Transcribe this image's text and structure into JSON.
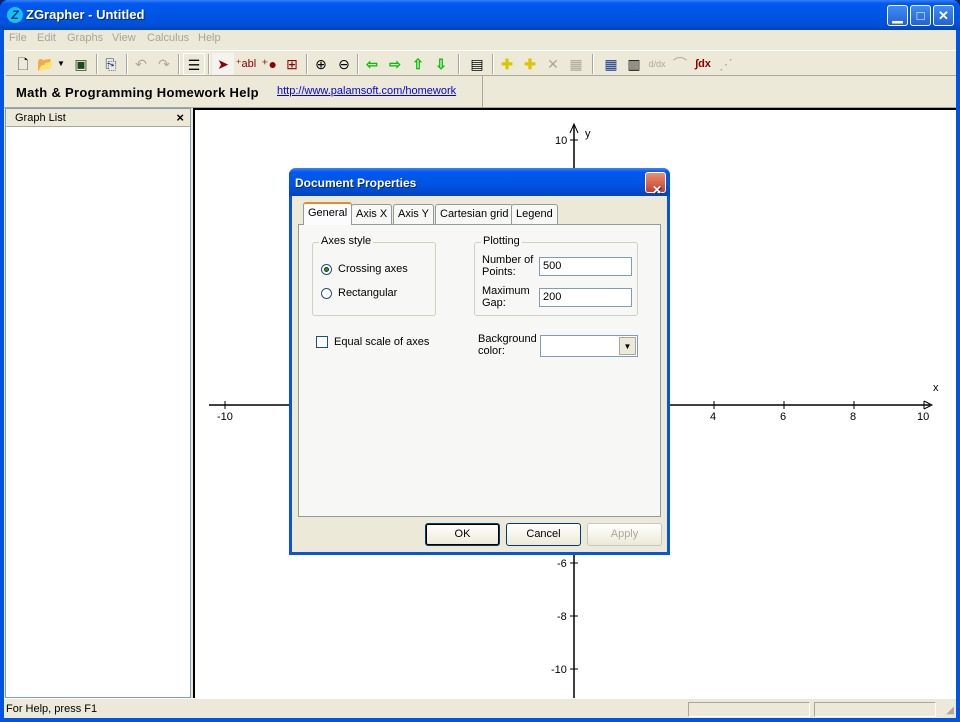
{
  "window": {
    "title": "ZGrapher - Untitled",
    "app_icon": "Z",
    "controls": {
      "minimize": "minimize-icon",
      "maximize": "maximize-icon",
      "close": "close-icon"
    }
  },
  "menu": [
    "File",
    "Edit",
    "Graphs",
    "View",
    "Calculus",
    "Help"
  ],
  "toolbar": [
    {
      "name": "new-icon",
      "glyph": "🗋"
    },
    {
      "name": "open-icon",
      "glyph": "📂"
    },
    {
      "name": "save-icon",
      "glyph": "💾"
    },
    {
      "name": "copy-icon",
      "glyph": "⎘"
    },
    {
      "name": "undo-icon",
      "glyph": "↶"
    },
    {
      "name": "redo-icon",
      "glyph": "↷"
    },
    {
      "name": "graph-list-icon",
      "glyph": "☰"
    },
    {
      "name": "select-pointer-icon",
      "glyph": "➤"
    },
    {
      "name": "add-label-icon",
      "glyph": "abl"
    },
    {
      "name": "add-point-icon",
      "glyph": "•"
    },
    {
      "name": "zoom-window-icon",
      "glyph": "⊞"
    },
    {
      "name": "zoom-in-icon",
      "glyph": "⊕"
    },
    {
      "name": "zoom-out-icon",
      "glyph": "⊖"
    },
    {
      "name": "pan-left-icon",
      "glyph": "⇦"
    },
    {
      "name": "pan-right-icon",
      "glyph": "⇨"
    },
    {
      "name": "pan-up-icon",
      "glyph": "⇧"
    },
    {
      "name": "pan-down-icon",
      "glyph": "⇩"
    },
    {
      "name": "document-properties-icon",
      "glyph": "▤"
    },
    {
      "name": "add-function-icon",
      "glyph": "✚"
    },
    {
      "name": "add-table-function-icon",
      "glyph": "✚"
    },
    {
      "name": "delete-graph-icon",
      "glyph": "✕"
    },
    {
      "name": "graph-properties-icon",
      "glyph": "▦"
    },
    {
      "name": "table-icon",
      "glyph": "▦"
    },
    {
      "name": "calculator-icon",
      "glyph": "▥"
    },
    {
      "name": "derivative-icon",
      "glyph": "d/dx"
    },
    {
      "name": "tangent-icon",
      "glyph": "⌒"
    },
    {
      "name": "integral-icon",
      "glyph": "∫dx"
    },
    {
      "name": "regression-icon",
      "glyph": "⋰"
    }
  ],
  "helpbar": {
    "title": "Math & Programming Homework Help",
    "link": "http://www.palamsoft.com/homework"
  },
  "graph_list": {
    "title": "Graph List",
    "close": "×"
  },
  "graph": {
    "x_label": "x",
    "y_label": "y",
    "x_range": [
      -10,
      10
    ],
    "y_range": [
      -10,
      10
    ],
    "x_ticks_visible": [
      "-10",
      "4",
      "6",
      "8",
      "10"
    ],
    "y_ticks_visible": [
      "10",
      "-6",
      "-8",
      "-10"
    ]
  },
  "dialog": {
    "title": "Document Properties",
    "tabs": [
      "General",
      "Axis X",
      "Axis Y",
      "Cartesian grid",
      "Legend"
    ],
    "active_tab": "General",
    "axes_style": {
      "legend": "Axes style",
      "options": [
        "Crossing axes",
        "Rectangular"
      ],
      "selected": "Crossing axes"
    },
    "plotting": {
      "legend": "Plotting",
      "points_label_1": "Number of",
      "points_label_2": "Points:",
      "points_value": "500",
      "gap_label_1": "Maximum",
      "gap_label_2": "Gap:",
      "gap_value": "200"
    },
    "equal_scale": {
      "label": "Equal scale of axes",
      "checked": false
    },
    "background": {
      "label_1": "Background",
      "label_2": "color:",
      "value": ""
    },
    "buttons": {
      "ok": "OK",
      "cancel": "Cancel",
      "apply": "Apply"
    }
  },
  "statusbar": {
    "text": "For Help, press F1"
  }
}
